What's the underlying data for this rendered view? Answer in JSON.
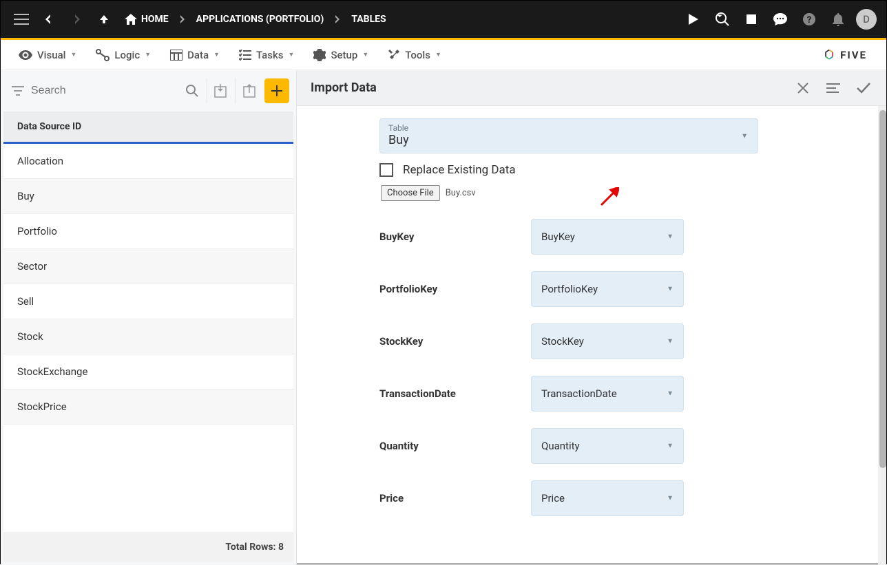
{
  "topbar": {
    "crumbs": [
      "HOME",
      "APPLICATIONS (PORTFOLIO)",
      "TABLES"
    ],
    "avatar": "D"
  },
  "menu": {
    "items": [
      "Visual",
      "Logic",
      "Data",
      "Tasks",
      "Setup",
      "Tools"
    ],
    "brand": "FIVE"
  },
  "left": {
    "search_placeholder": "Search",
    "header": "Data Source ID",
    "items": [
      "Allocation",
      "Buy",
      "Portfolio",
      "Sector",
      "Sell",
      "Stock",
      "StockExchange",
      "StockPrice"
    ],
    "footer": "Total Rows: 8"
  },
  "form": {
    "title": "Import Data",
    "table_label": "Table",
    "table_value": "Buy",
    "replace_label": "Replace Existing Data",
    "choose_file_label": "Choose File",
    "file_name": "Buy.csv",
    "mappings": [
      {
        "label": "BuyKey",
        "value": "BuyKey"
      },
      {
        "label": "PortfolioKey",
        "value": "PortfolioKey"
      },
      {
        "label": "StockKey",
        "value": "StockKey"
      },
      {
        "label": "TransactionDate",
        "value": "TransactionDate"
      },
      {
        "label": "Quantity",
        "value": "Quantity"
      },
      {
        "label": "Price",
        "value": "Price"
      }
    ]
  }
}
